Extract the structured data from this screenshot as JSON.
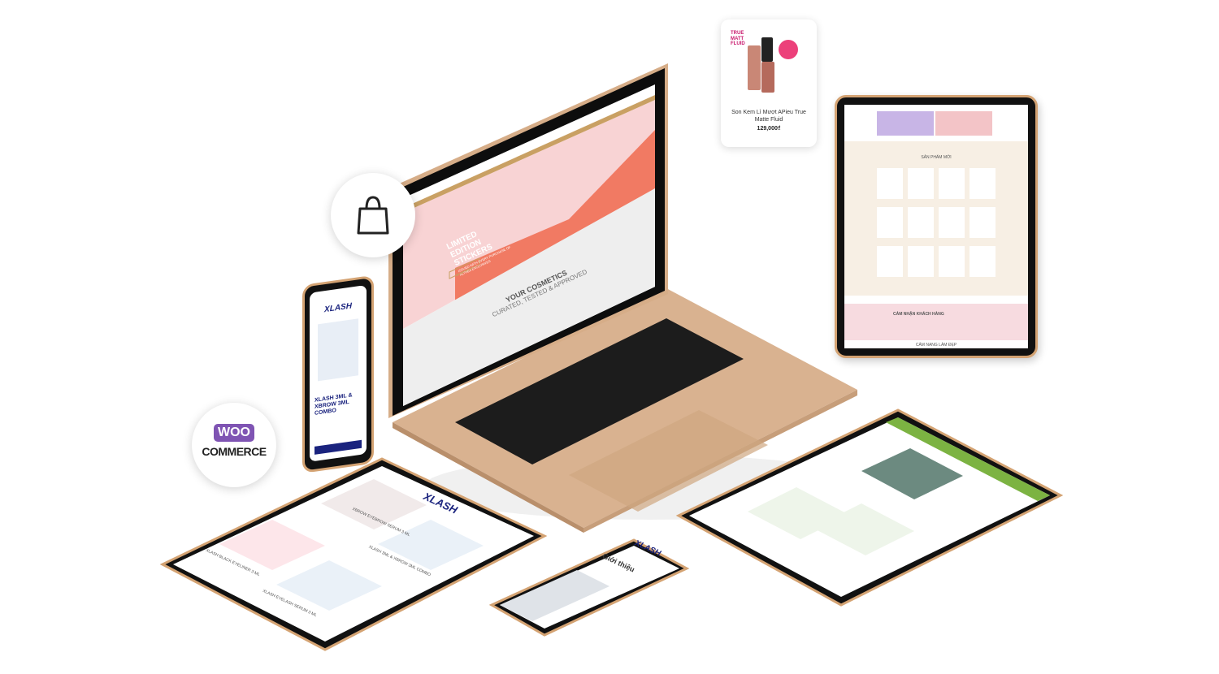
{
  "product_card": {
    "brand_lines": [
      "TRUE",
      "MATT",
      "FLUID"
    ],
    "name": "Son Kem Lì Mượt APieu True Matte Fluid",
    "price": "129,000₫"
  },
  "woocommerce_badge": {
    "logo_text": "WOO",
    "wordmark": "COMMERCE"
  },
  "laptop_screen": {
    "hero_title": "LIMITED EDITION STICKERS",
    "hero_subtitle": "ISSUED WITH EVERY PURCHASE OF ALTHEA EXCLUSIVES",
    "hero_button": "SHOP NOW",
    "section_title": "YOUR COSMETICS",
    "section_subtitle": "CURATED, TESTED & APPROVED"
  },
  "tablet_right": {
    "section_new": "SẢN PHẨM MỚI",
    "section_reviews": "CẢM NHẬN KHÁCH HÀNG",
    "section_beauty": "CẨM NANG LÀM ĐẸP"
  },
  "phone_left": {
    "logo": "XLASH",
    "product_title": "XLASH 3ML & XBROW 3ML COMBO"
  },
  "tablet_bottom_left": {
    "logo": "XLASH",
    "items": [
      "XBROW EYEBROW SERUM 3 ML",
      "XLASH 3ML & XBROW 3ML COMBO",
      "XLASH BLACK EYELINER 3 ML",
      "XLASH EYELASH SERUM 3 ML"
    ]
  },
  "phone_bottom": {
    "logo": "XLASH",
    "heading": "Giới thiệu"
  },
  "colors": {
    "gold": "#d4a373",
    "woo_purple": "#7f54b3",
    "pink": "#f6c6cc",
    "coral": "#f0553f",
    "green": "#7cb342"
  }
}
